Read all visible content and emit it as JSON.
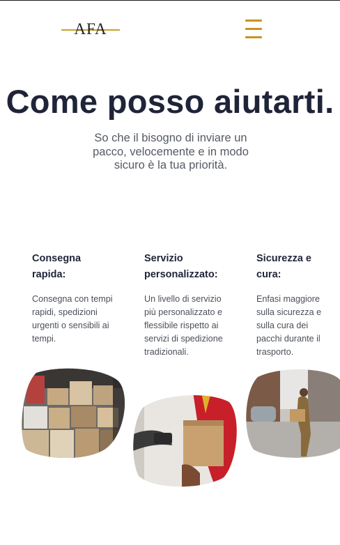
{
  "header": {
    "logo_text": "AFA",
    "menu_icon": "hamburger-menu-icon"
  },
  "hero": {
    "title": "Come posso aiutarti.",
    "subtitle": "So che il bisogno di inviare un pacco, velocemente e in modo sicuro è la tua priorità."
  },
  "features": [
    {
      "title": "Consegna rapida:",
      "text": "Consegna con tempi rapidi, spedizioni urgenti o sensibili ai tempi.",
      "image": "warehouse-boxes-photo"
    },
    {
      "title": "Servizio personalizzato:",
      "text": "Un livello di servizio più personalizzato e flessibile rispetto ai servizi di spedizione tradizionali.",
      "image": "courier-delivery-photo"
    },
    {
      "title": "Sicurezza e cura:",
      "text": "Enfasi maggiore sulla sicurezza e sulla cura dei pacchi durante il trasporto.",
      "image": "street-courier-photo"
    }
  ],
  "colors": {
    "accent": "#c9a227",
    "title": "#1f2438",
    "body_text": "#4a4f58"
  }
}
